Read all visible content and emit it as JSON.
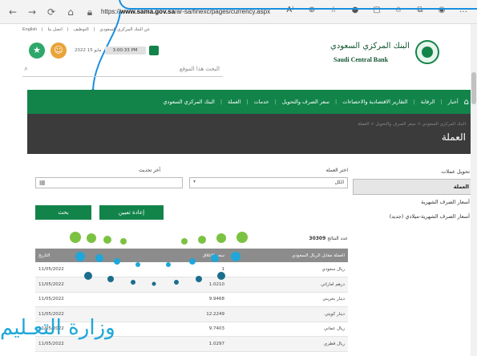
{
  "browser": {
    "url_prefix": "https://",
    "url_domain": "www.sama.gov.sa",
    "url_path": "/ar-sa/finexc/pages/currency.aspx"
  },
  "header": {
    "util_links": [
      "English",
      "اتصل بنا",
      "التوظيف",
      "عن البنك المركزي السعودي"
    ],
    "date": "2022 مايو 15",
    "time": "3:00:33 PM",
    "search_placeholder": "البحث هذا الموقع",
    "logo_ar": "البنك المركزي السعودي",
    "logo_en": "Saudi Central Bank"
  },
  "nav": {
    "items": [
      "أخبار",
      "الرقابة",
      "التقارير الاقتصادية والاحصاءات",
      "سعر الصرف والتحويل",
      "خدمات",
      "العملة",
      "البنك المركزي السعودي"
    ]
  },
  "banner": {
    "breadcrumb": "البنك المركزي السعودي > سعر الصرف والتحويل > العملة",
    "title": "العملة"
  },
  "sidebar": {
    "items": [
      {
        "label": "تحويل عملات",
        "active": false
      },
      {
        "label": "العملة",
        "active": true
      },
      {
        "label": "أسعار الصرف الشهرية",
        "active": false
      },
      {
        "label": "أسعار الصرف الشهرية-ميلادي (جديد)",
        "active": false
      }
    ]
  },
  "form": {
    "currency_label": "اختر العملة",
    "currency_value": "الكل",
    "update_label": "آخر تحديث",
    "reset_button": "إعادة تعيين",
    "search_button": "بحث"
  },
  "results": {
    "count_label": "عدد النتائج",
    "count_value": "30309",
    "headers": [
      "العملة مقابل الريال السعودي",
      "سعر الإغلاق",
      "التاريخ"
    ],
    "rows": [
      {
        "name": "ريال سعودي",
        "value": "1",
        "date": "11/05/2022"
      },
      {
        "name": "درهم اماراتي",
        "value": "1.0210",
        "date": "11/05/2022"
      },
      {
        "name": "دينار بحريني",
        "value": "9.9468",
        "date": "11/05/2022"
      },
      {
        "name": "دينار كويتي",
        "value": "12.2249",
        "date": "11/05/2022"
      },
      {
        "name": "ريال عماني",
        "value": "9.7403",
        "date": "11/05/2022"
      },
      {
        "name": "ريال قطري",
        "value": "1.0297",
        "date": "11/05/2022"
      }
    ]
  },
  "watermark": {
    "text": "وزارة التعـليم"
  },
  "colors": {
    "brand_green": "#12844a",
    "banner_dark": "#3b3b3b",
    "callout_blue": "#1a8fe0",
    "watermark_green": "#7cc242",
    "watermark_blue": "#1ea7d8",
    "star_green": "#2ea86a",
    "person_orange": "#e8a33a"
  }
}
